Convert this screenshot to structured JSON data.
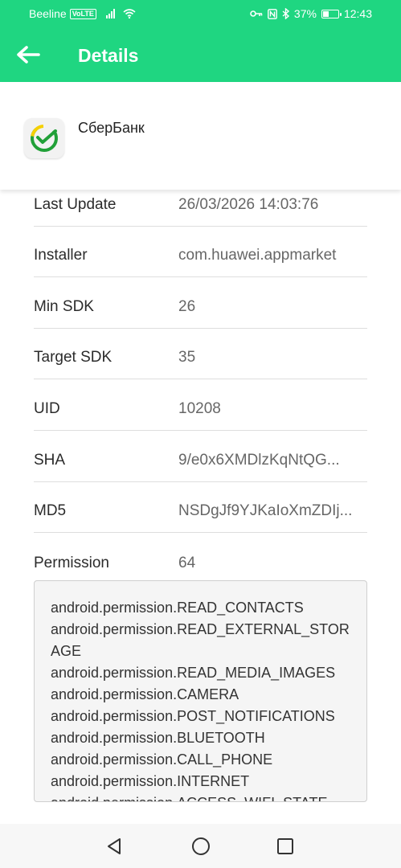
{
  "status_bar": {
    "carrier": "Beeline",
    "volte": "VoLTE",
    "battery": "37%",
    "battery_level": 0.37,
    "time": "12:43"
  },
  "app_bar": {
    "title": "Details",
    "back_icon": "arrow-left-icon"
  },
  "app": {
    "name": "СберБанк",
    "icon": "sberbank-logo-icon",
    "brand_colors": [
      "#21a038",
      "#f5d000",
      "#0091ff"
    ]
  },
  "details": [
    {
      "key": "Last Update",
      "value": "26/03/2026 14:03:76"
    },
    {
      "key": "Installer",
      "value": "com.huawei.appmarket"
    },
    {
      "key": "Min SDK",
      "value": "26"
    },
    {
      "key": "Target SDK",
      "value": "35"
    },
    {
      "key": "UID",
      "value": "10208"
    },
    {
      "key": "SHA",
      "value": "9/e0x6XMDlzKqNtQG..."
    },
    {
      "key": "MD5",
      "value": "NSDgJf9YJKaIoXmZDIj..."
    },
    {
      "key": "Permission",
      "value": "64"
    }
  ],
  "permissions": [
    "android.permission.READ_CONTACTS",
    "android.permission.READ_EXTERNAL_STORAGE",
    "android.permission.READ_MEDIA_IMAGES",
    "android.permission.CAMERA",
    "android.permission.POST_NOTIFICATIONS",
    "android.permission.BLUETOOTH",
    "android.permission.CALL_PHONE",
    "android.permission.INTERNET",
    "android.permission.ACCESS_WIFI_STATE"
  ],
  "nav_bar": {
    "back": "nav-back-icon",
    "home": "nav-home-icon",
    "recents": "nav-recents-icon"
  },
  "colors": {
    "header": "#1fd681",
    "header_text": "#ffffff"
  }
}
